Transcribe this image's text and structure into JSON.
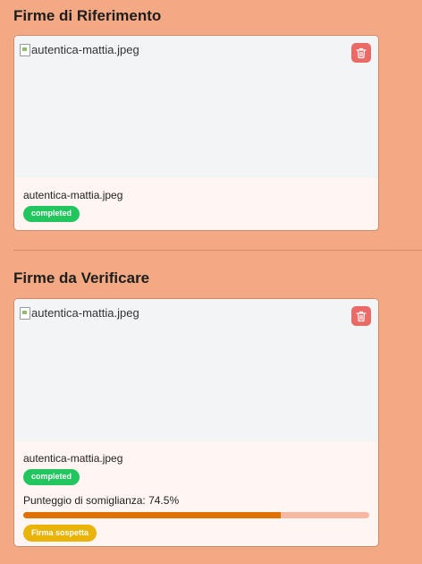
{
  "reference": {
    "title": "Firme di Riferimento",
    "card": {
      "image_alt": "autentica-mattia.jpeg",
      "file_name": "autentica-mattia.jpeg",
      "status": "completed"
    }
  },
  "verify": {
    "title": "Firme da Verificare",
    "card": {
      "image_alt": "autentica-mattia.jpeg",
      "file_name": "autentica-mattia.jpeg",
      "status": "completed",
      "score_label": "Punteggio di somiglianza: 74.5%",
      "score_percent": 74.5,
      "verdict": "Firma sospetta"
    }
  },
  "icons": {
    "delete": "trash-icon",
    "broken_image": "broken-image-icon"
  },
  "colors": {
    "background": "#f3a983",
    "completed": "#22c55e",
    "delete": "#eb6a66",
    "progress": "#e07000",
    "suspect": "#eab308"
  }
}
